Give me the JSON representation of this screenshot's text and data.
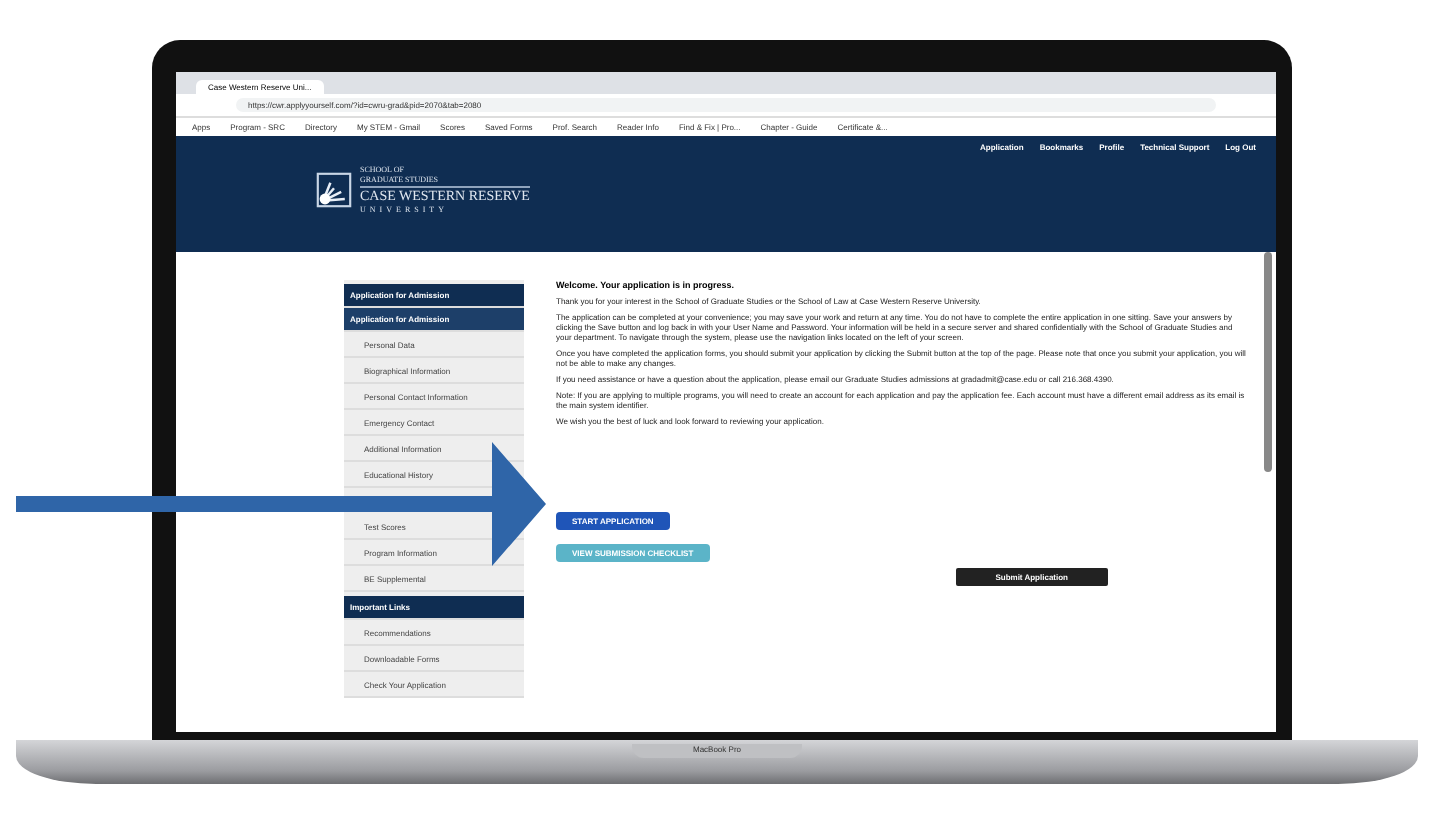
{
  "browser": {
    "tab_title": "Case Western Reserve Uni...",
    "url": "https://cwr.applyyourself.com/?id=cwru-grad&pid=2070&tab=2080",
    "bookmarks": [
      "Apps",
      "Program - SRC",
      "Directory",
      "My STEM - Gmail",
      "Scores",
      "Saved Forms",
      "Prof. Search",
      "Reader Info",
      "Find & Fix | Pro...",
      "Chapter - Guide",
      "Certificate &..."
    ]
  },
  "header": {
    "logo_lines": [
      "SCHOOL OF",
      "GRADUATE STUDIES"
    ],
    "logo_name": "CASE WESTERN RESERVE",
    "logo_sub": "UNIVERSITY",
    "nav": [
      "Application",
      "Bookmarks",
      "Profile",
      "Technical Support",
      "Log Out"
    ]
  },
  "sidebar": [
    {
      "kind": "header",
      "label": "Application for Admission"
    },
    {
      "kind": "subheader",
      "label": "Application for Admission"
    },
    {
      "kind": "item",
      "label": "Personal Data"
    },
    {
      "kind": "item",
      "label": "Biographical Information"
    },
    {
      "kind": "item",
      "label": "Personal Contact Information"
    },
    {
      "kind": "item",
      "label": "Emergency Contact"
    },
    {
      "kind": "item",
      "label": "Additional Information"
    },
    {
      "kind": "item",
      "label": "Educational History"
    },
    {
      "kind": "item",
      "label": "Test Scores"
    },
    {
      "kind": "item",
      "label": "Program Information"
    },
    {
      "kind": "item",
      "label": "BE Supplemental"
    },
    {
      "kind": "header",
      "label": "Important Links"
    },
    {
      "kind": "item",
      "label": "Recommendations"
    },
    {
      "kind": "item",
      "label": "Downloadable Forms"
    },
    {
      "kind": "item",
      "label": "Check Your Application"
    }
  ],
  "content": {
    "heading": "Welcome. Your application is in progress.",
    "paragraphs": [
      "Thank you for your interest in the School of Graduate Studies or the School of Law at Case Western Reserve University.",
      "The application can be completed at your convenience; you may save your work and return at any time. You do not have to complete the entire application in one sitting. Save your answers by clicking the Save button and log back in with your User Name and Password. Your information will be held in a secure server and shared confidentially with the School of Graduate Studies and your department. To navigate through the system, please use the navigation links located on the left of your screen.",
      "Once you have completed the application forms, you should submit your application by clicking the Submit button at the top of the page. Please note that once you submit your application, you will not be able to make any changes.",
      "If you need assistance or have a question about the application, please email our Graduate Studies admissions at gradadmit@case.edu or call 216.368.4390.",
      "Note: If you are applying to multiple programs, you will need to create an account for each application and pay the application fee. Each account must have a different email address as its email is the main system identifier.",
      "We wish you the best of luck and look forward to reviewing your application."
    ],
    "buttons": [
      {
        "kind": "primary",
        "label": "START APPLICATION"
      },
      {
        "kind": "secondary",
        "label": "VIEW SUBMISSION CHECKLIST"
      }
    ],
    "submit": "Submit Application"
  },
  "device_label": "MacBook Pro"
}
